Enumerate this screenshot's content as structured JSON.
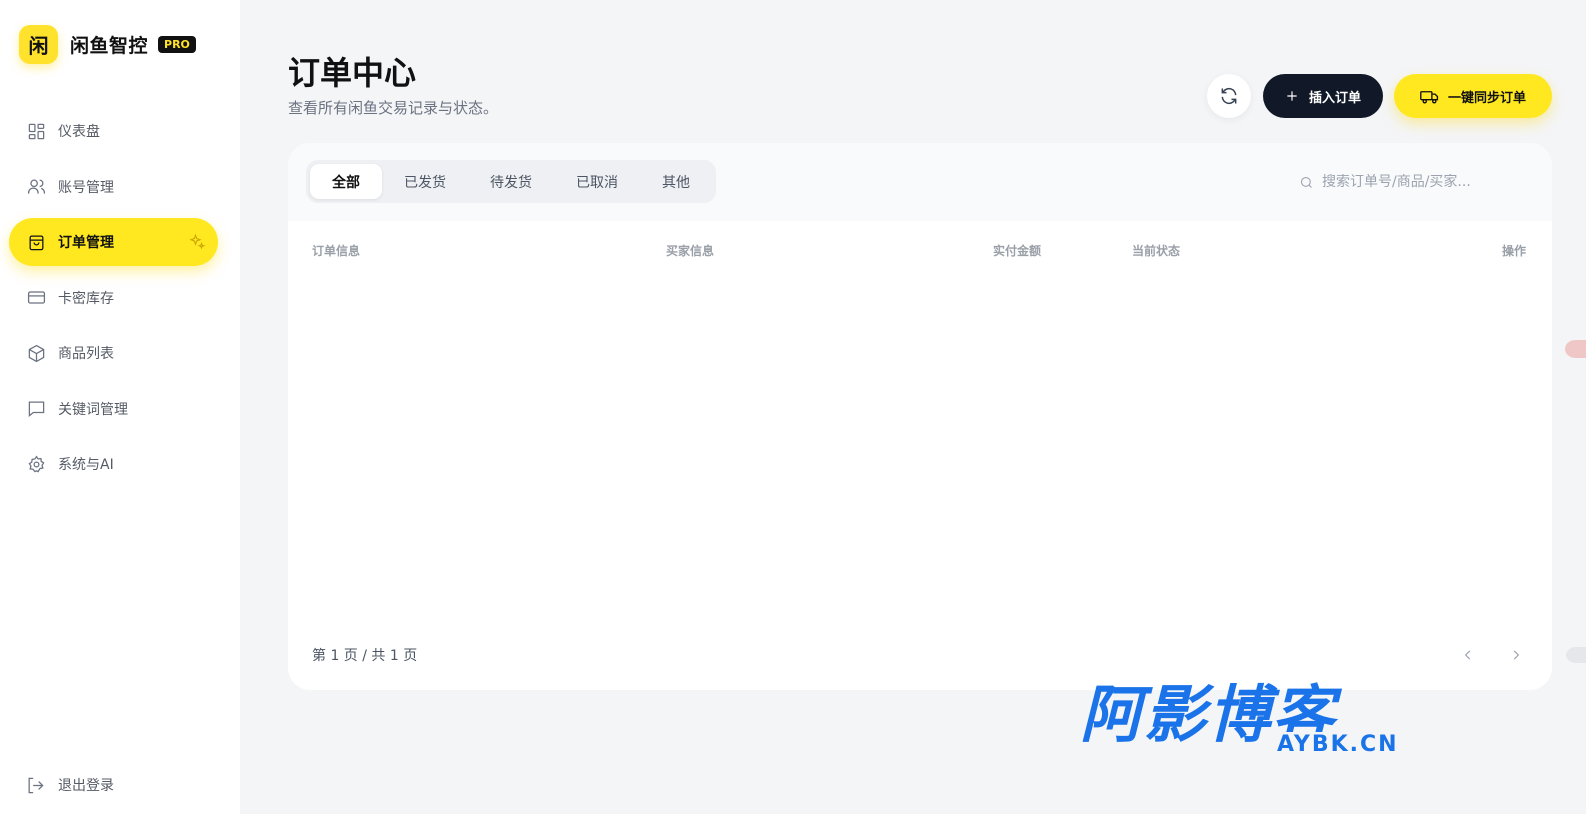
{
  "brand": {
    "logo_char": "闲",
    "name": "闲鱼智控",
    "badge": "PRO"
  },
  "sidebar": {
    "items": [
      {
        "label": "仪表盘",
        "icon": "dashboard-icon"
      },
      {
        "label": "账号管理",
        "icon": "users-icon"
      },
      {
        "label": "订单管理",
        "icon": "shopping-bag-icon",
        "active": true
      },
      {
        "label": "卡密库存",
        "icon": "card-icon"
      },
      {
        "label": "商品列表",
        "icon": "box-icon"
      },
      {
        "label": "关键词管理",
        "icon": "message-icon"
      },
      {
        "label": "系统与AI",
        "icon": "gear-icon"
      }
    ],
    "logout_label": "退出登录"
  },
  "header": {
    "title": "订单中心",
    "subtitle": "查看所有闲鱼交易记录与状态。",
    "insert_label": "插入订单",
    "sync_label": "一键同步订单"
  },
  "tabs": [
    {
      "label": "全部",
      "active": true
    },
    {
      "label": "已发货"
    },
    {
      "label": "待发货"
    },
    {
      "label": "已取消"
    },
    {
      "label": "其他"
    }
  ],
  "search": {
    "placeholder": "搜索订单号/商品/买家...",
    "value": ""
  },
  "table": {
    "columns": [
      "订单信息",
      "买家信息",
      "实付金额",
      "当前状态",
      "操作"
    ],
    "rows": []
  },
  "pagination": {
    "text": "第 1 页 / 共 1 页"
  },
  "watermark": {
    "main": "阿影博客",
    "sub": "AYBK.CN"
  },
  "colors": {
    "accent": "#ffe81f",
    "dark": "#111827",
    "watermark": "#1a73e8"
  }
}
